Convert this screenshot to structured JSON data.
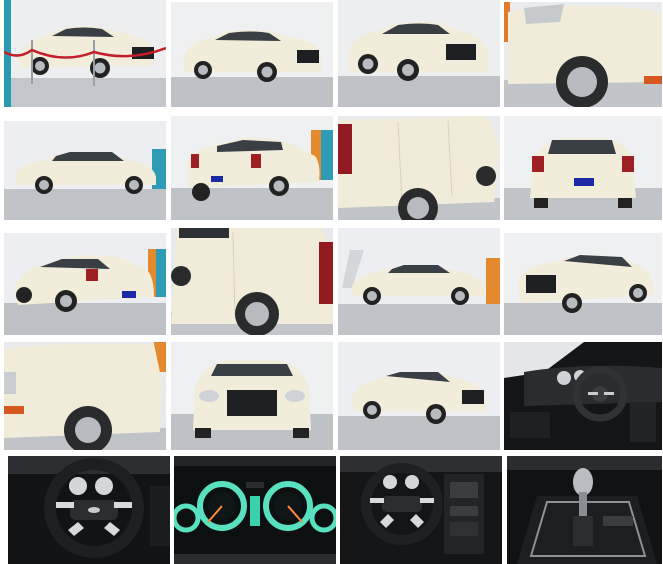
{
  "gallery": {
    "photos": [
      {
        "view": "front-three-quarter-showroom-rope"
      },
      {
        "view": "front-three-quarter"
      },
      {
        "view": "front-three-quarter-close"
      },
      {
        "view": "rear-fender-closeup"
      },
      {
        "view": "side-profile"
      },
      {
        "view": "rear-three-quarter"
      },
      {
        "view": "rear-door-closeup"
      },
      {
        "view": "rear"
      },
      {
        "view": "rear-three-quarter-left"
      },
      {
        "view": "front-door-closeup"
      },
      {
        "view": "side-profile-far"
      },
      {
        "view": "front-three-quarter-right"
      },
      {
        "view": "front-fender-closeup"
      },
      {
        "view": "front"
      },
      {
        "view": "front-three-quarter-far"
      },
      {
        "view": "dashboard-interior"
      },
      {
        "view": "steering-wheel"
      },
      {
        "view": "instrument-cluster"
      },
      {
        "view": "steering-wheel-dash"
      },
      {
        "view": "gear-shifter"
      }
    ],
    "colors": {
      "car_body": "#f1ecd9",
      "floor": "#bcbfc3",
      "wall": "#eef0f2",
      "cluster_glow": "#58e0bf",
      "interior": "#1b1c1e"
    }
  }
}
